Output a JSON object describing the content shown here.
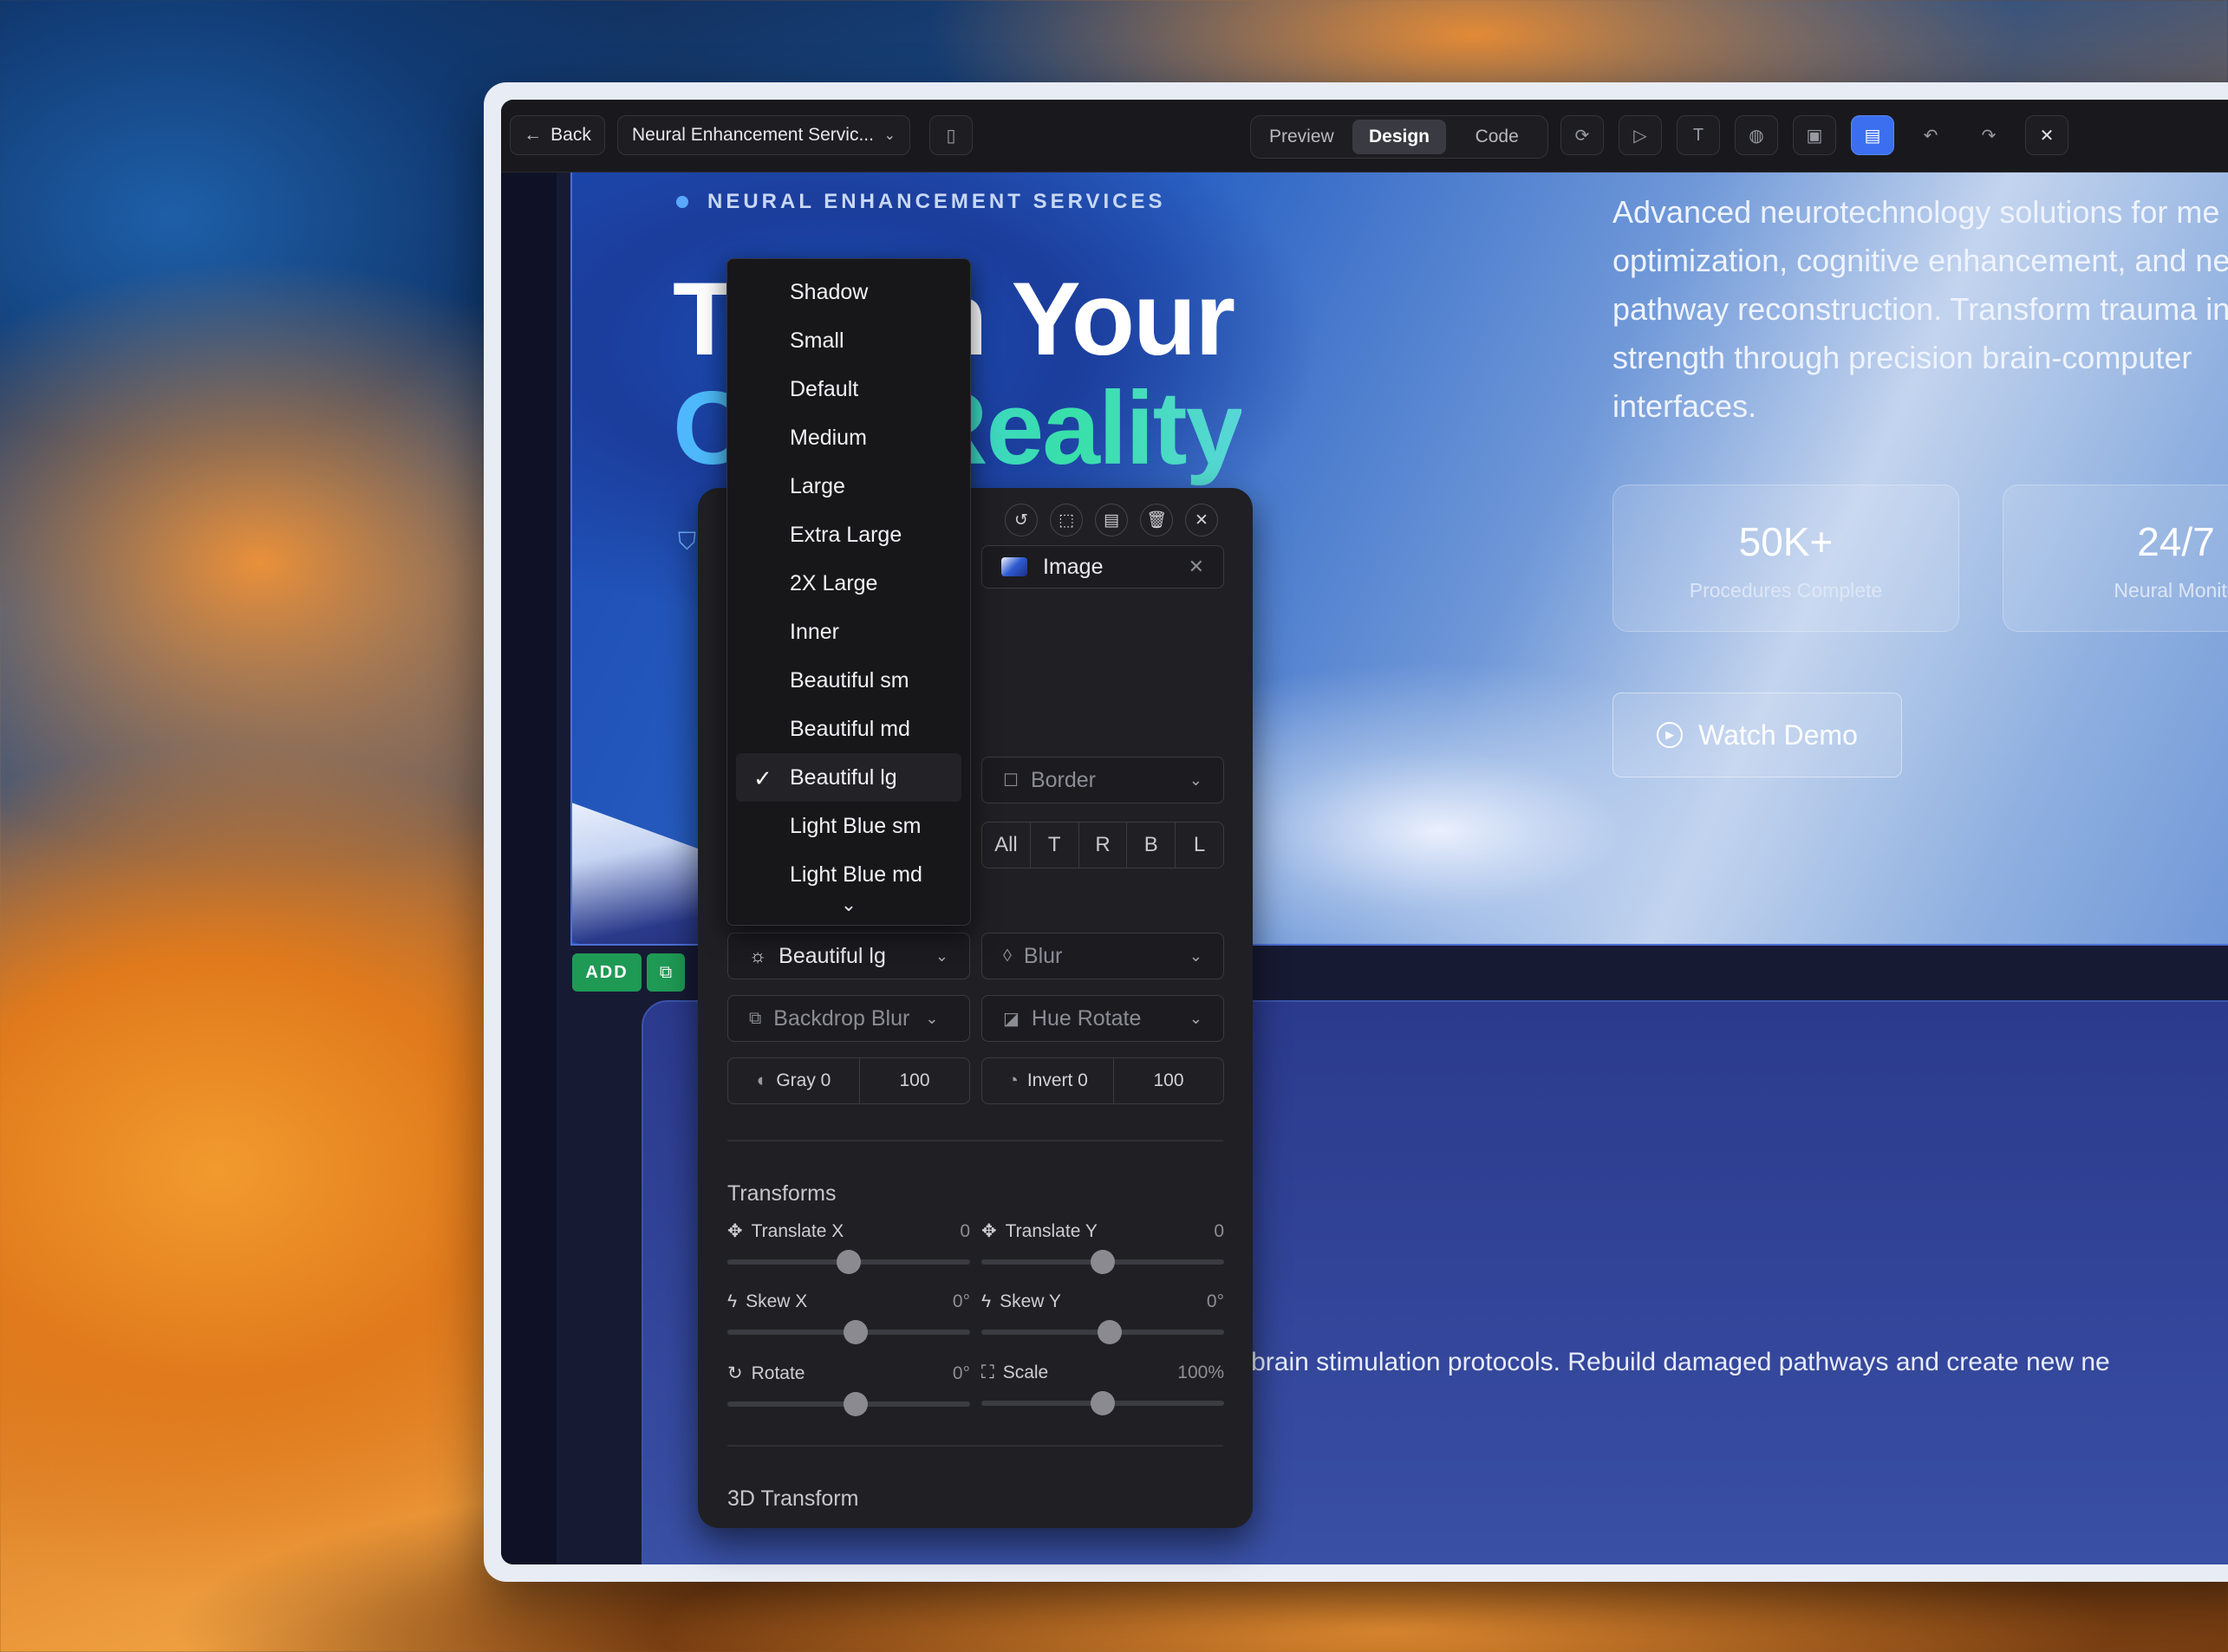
{
  "topbar": {
    "back_label": "Back",
    "project_name": "Neural Enhancement Servic...",
    "modes": [
      "Preview",
      "Design",
      "Code"
    ],
    "active_mode": "Design"
  },
  "hero": {
    "eyebrow": "NEURAL ENHANCEMENT SERVICES",
    "headline_line1": "Tr         orm Your",
    "headline_line2": "C         ve Reality",
    "description": "Advanced neurotechnology solutions for me optimization, cognitive enhancement, and ne pathway reconstruction. Transform trauma in strength through precision brain-computer interfaces.",
    "stats": [
      {
        "value": "50K+",
        "label": "Procedures Complete"
      },
      {
        "value": "24/7",
        "label": "Neural Monito"
      }
    ],
    "watch_demo_label": "Watch Demo"
  },
  "canvas": {
    "add_label": "ADD",
    "section2_text": "m-enhanced brain stimulation protocols. Rebuild damaged pathways and create new ne"
  },
  "panel": {
    "image_chip_label": "Image",
    "border_label": "Border",
    "border_sides": [
      "All",
      "T",
      "R",
      "B",
      "L"
    ],
    "shadow_selected": "Beautiful lg",
    "blur_label": "Blur",
    "backdrop_blur_label": "Backdrop Blur",
    "hue_rotate_label": "Hue Rotate",
    "gray_label": "Gray 0",
    "gray_value": "100",
    "invert_label": "Invert 0",
    "invert_value": "100",
    "transforms_title": "Transforms",
    "sliders": [
      {
        "label": "Translate X",
        "value": "0",
        "level": 0.5
      },
      {
        "label": "Translate Y",
        "value": "0",
        "level": 0.5
      },
      {
        "label": "Skew X",
        "value": "0°",
        "level": 0.53
      },
      {
        "label": "Skew Y",
        "value": "0°",
        "level": 0.53
      },
      {
        "label": "Rotate",
        "value": "0°",
        "level": 0.53
      },
      {
        "label": "Scale",
        "value": "100%",
        "level": 0.5
      }
    ],
    "transform3d_title": "3D Transform"
  },
  "dropdown": {
    "items": [
      "Shadow",
      "Small",
      "Default",
      "Medium",
      "Large",
      "Extra Large",
      "2X Large",
      "Inner",
      "Beautiful sm",
      "Beautiful md",
      "Beautiful lg",
      "Light Blue sm",
      "Light Blue md"
    ],
    "selected": "Beautiful lg"
  },
  "colors": {
    "accent_blue": "#3b6ff0",
    "add_green": "#1f9a55",
    "heading_gradient_start": "#4fb6ff",
    "heading_gradient_end": "#38e0a8"
  }
}
